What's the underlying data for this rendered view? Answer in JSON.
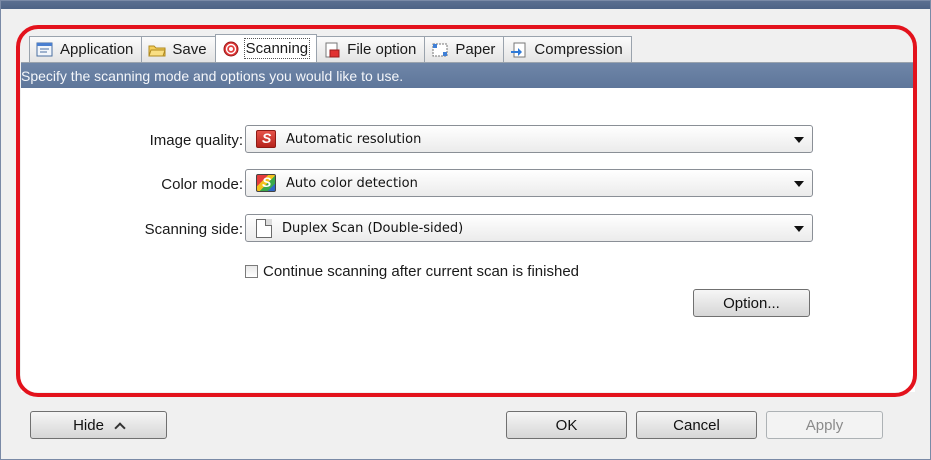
{
  "tabs": [
    {
      "label": "Application",
      "icon": "application-icon"
    },
    {
      "label": "Save",
      "icon": "folder-icon"
    },
    {
      "label": "Scanning",
      "icon": "scanning-icon"
    },
    {
      "label": "File option",
      "icon": "file-option-icon"
    },
    {
      "label": "Paper",
      "icon": "paper-icon"
    },
    {
      "label": "Compression",
      "icon": "compression-icon"
    }
  ],
  "active_tab": "Scanning",
  "header": "Specify the scanning mode and options you would like to use.",
  "fields": {
    "image_quality": {
      "label": "Image quality:",
      "value": "Automatic resolution",
      "icon": "scansnap-red-icon"
    },
    "color_mode": {
      "label": "Color mode:",
      "value": "Auto color detection",
      "icon": "scansnap-color-icon"
    },
    "scanning_side": {
      "label": "Scanning side:",
      "value": "Duplex Scan (Double-sided)",
      "icon": "document-icon"
    }
  },
  "continue_scanning": {
    "label": "Continue scanning after current scan is finished",
    "checked": false
  },
  "buttons": {
    "option": "Option...",
    "hide": "Hide",
    "ok": "OK",
    "cancel": "Cancel",
    "apply": "Apply"
  },
  "colors": {
    "highlight": "#e3121c",
    "header_bar": "#6a81a4",
    "title_bar": "#51688b"
  }
}
